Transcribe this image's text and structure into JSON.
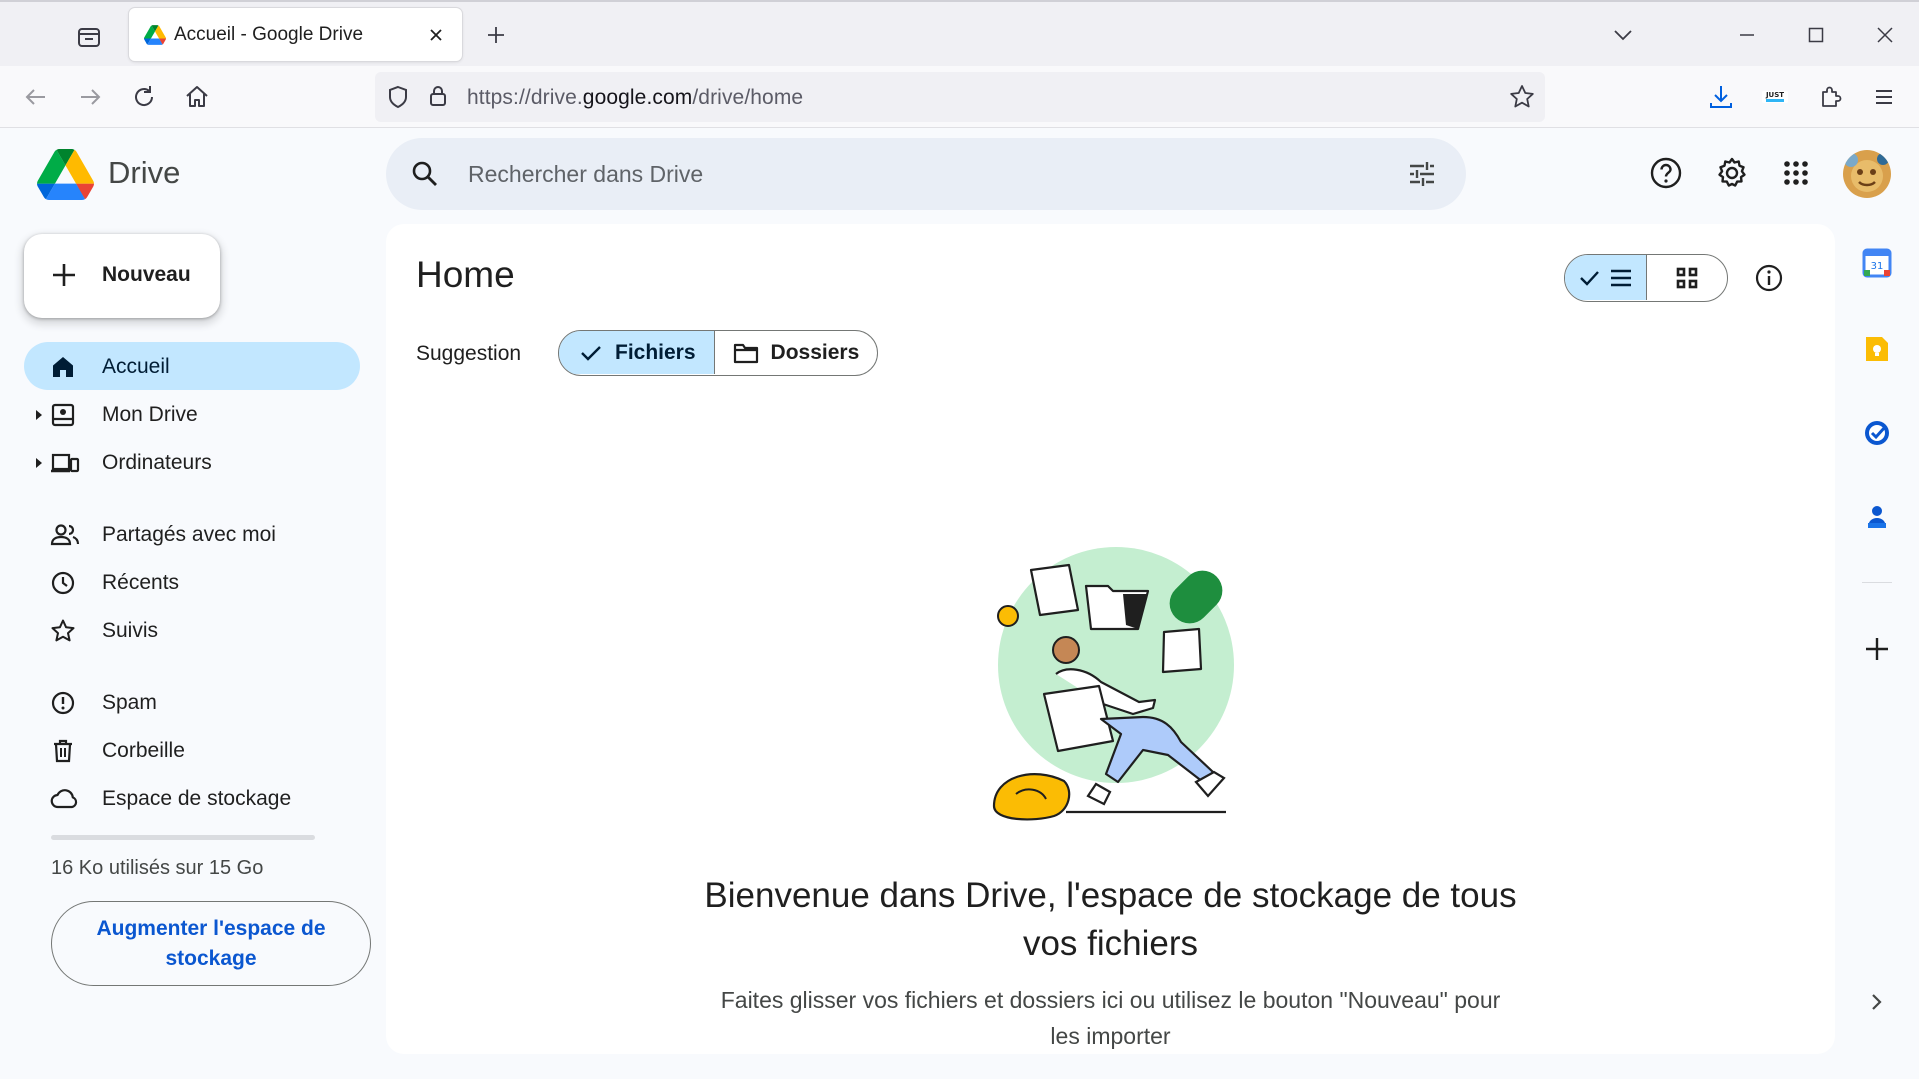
{
  "browser": {
    "tab_title": "Accueil - Google Drive",
    "url_prefix": "https://drive.",
    "url_domain": "google.com",
    "url_path": "/drive/home"
  },
  "app": {
    "name": "Drive",
    "search_placeholder": "Rechercher dans Drive"
  },
  "sidebar": {
    "new_label": "Nouveau",
    "items": [
      {
        "label": "Accueil",
        "icon": "home-icon",
        "active": true
      },
      {
        "label": "Mon Drive",
        "icon": "my-drive-icon"
      },
      {
        "label": "Ordinateurs",
        "icon": "computers-icon"
      },
      {
        "label": "Partagés avec moi",
        "icon": "shared-icon"
      },
      {
        "label": "Récents",
        "icon": "clock-icon"
      },
      {
        "label": "Suivis",
        "icon": "star-icon"
      },
      {
        "label": "Spam",
        "icon": "spam-icon"
      },
      {
        "label": "Corbeille",
        "icon": "trash-icon"
      },
      {
        "label": "Espace de stockage",
        "icon": "cloud-icon"
      }
    ],
    "storage_text": "16 Ko utilisés sur 15 Go",
    "storage_fraction": 0.0,
    "upgrade_label": "Augmenter l'espace de stockage"
  },
  "main": {
    "title": "Home",
    "suggestion_label": "Suggestion",
    "chip_files": "Fichiers",
    "chip_folders": "Dossiers",
    "welcome_title": "Bienvenue dans Drive, l'espace de stockage de tous vos fichiers",
    "welcome_subtitle": "Faites glisser vos fichiers et dossiers ici ou utilisez le bouton \"Nouveau\" pour les importer"
  },
  "side_panel": {
    "calendar_day": "31"
  },
  "colors": {
    "accent_blue": "#0b57d0",
    "active_bg": "#c2e7ff",
    "page_bg": "#f8fafd"
  }
}
